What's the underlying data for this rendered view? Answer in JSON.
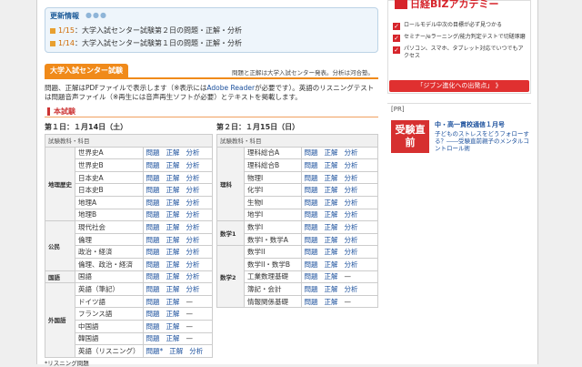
{
  "news": {
    "title": "更新情報",
    "dots": "●●●",
    "items": [
      {
        "date": "1/15",
        "text": "：大学入試センター試験第２日の問題・正解・分析"
      },
      {
        "date": "1/14",
        "text": "：大学入試センター試験第１日の問題・正解・分析"
      }
    ]
  },
  "section": {
    "tab": "大学入試センター試験",
    "note": "問題と正解は大学入試センター発表。分析は河合塾。",
    "intro_a": "問題、正解はPDFファイルで表示します（※表示には",
    "intro_link": "Adobe Reader",
    "intro_b": "が必要です）。英語のリスニングテストは問題音声ファイル（※再生には音声再生ソフトが必要）とテキストを掲載します。",
    "honshiken": "本試験"
  },
  "day1": {
    "title": "第１日：１月14日（土）",
    "header": "試験教科・科目",
    "groups": [
      {
        "cat": "地理歴史",
        "rows": [
          {
            "subj": "世界史A",
            "links": [
              "問題",
              "正解",
              "分析"
            ]
          },
          {
            "subj": "世界史B",
            "links": [
              "問題",
              "正解",
              "分析"
            ]
          },
          {
            "subj": "日本史A",
            "links": [
              "問題",
              "正解",
              "分析"
            ]
          },
          {
            "subj": "日本史B",
            "links": [
              "問題",
              "正解",
              "分析"
            ]
          },
          {
            "subj": "地理A",
            "links": [
              "問題",
              "正解",
              "分析"
            ]
          },
          {
            "subj": "地理B",
            "links": [
              "問題",
              "正解",
              "分析"
            ]
          }
        ]
      },
      {
        "cat": "公民",
        "rows": [
          {
            "subj": "現代社会",
            "links": [
              "問題",
              "正解",
              "分析"
            ]
          },
          {
            "subj": "倫理",
            "links": [
              "問題",
              "正解",
              "分析"
            ]
          },
          {
            "subj": "政治・経済",
            "links": [
              "問題",
              "正解",
              "分析"
            ]
          },
          {
            "subj": "倫理、政治・経済",
            "links": [
              "問題",
              "正解",
              "分析"
            ]
          }
        ]
      },
      {
        "cat": "国語",
        "rows": [
          {
            "subj": "国語",
            "links": [
              "問題",
              "正解",
              "分析"
            ]
          }
        ]
      },
      {
        "cat": "外国語",
        "rows": [
          {
            "subj": "英語（筆記）",
            "links": [
              "問題",
              "正解",
              "分析"
            ]
          },
          {
            "subj": "ドイツ語",
            "links": [
              "問題",
              "正解",
              "—"
            ]
          },
          {
            "subj": "フランス語",
            "links": [
              "問題",
              "正解",
              "—"
            ]
          },
          {
            "subj": "中国語",
            "links": [
              "問題",
              "正解",
              "—"
            ]
          },
          {
            "subj": "韓国語",
            "links": [
              "問題",
              "正解",
              "—"
            ]
          },
          {
            "subj": "英語（リスニング）",
            "links": [
              "問題*",
              "正解",
              "分析"
            ]
          }
        ]
      }
    ]
  },
  "day2": {
    "title": "第２日：１月15日（日）",
    "header": "試験教科・科目",
    "groups": [
      {
        "cat": "理科",
        "rows": [
          {
            "subj": "理科総合A",
            "links": [
              "問題",
              "正解",
              "分析"
            ]
          },
          {
            "subj": "理科総合B",
            "links": [
              "問題",
              "正解",
              "分析"
            ]
          },
          {
            "subj": "物理I",
            "links": [
              "問題",
              "正解",
              "分析"
            ]
          },
          {
            "subj": "化学I",
            "links": [
              "問題",
              "正解",
              "分析"
            ]
          },
          {
            "subj": "生物I",
            "links": [
              "問題",
              "正解",
              "分析"
            ]
          },
          {
            "subj": "地学I",
            "links": [
              "問題",
              "正解",
              "分析"
            ]
          }
        ]
      },
      {
        "cat": "数学1",
        "rows": [
          {
            "subj": "数学I",
            "links": [
              "問題",
              "正解",
              "分析"
            ]
          },
          {
            "subj": "数学I・数学A",
            "links": [
              "問題",
              "正解",
              "分析"
            ]
          }
        ]
      },
      {
        "cat": "数学2",
        "rows": [
          {
            "subj": "数学II",
            "links": [
              "問題",
              "正解",
              "分析"
            ]
          },
          {
            "subj": "数学II・数学B",
            "links": [
              "問題",
              "正解",
              "分析"
            ]
          },
          {
            "subj": "工業数理基礎",
            "links": [
              "問題",
              "正解",
              "—"
            ]
          },
          {
            "subj": "簿記・会計",
            "links": [
              "問題",
              "正解",
              "分析"
            ]
          },
          {
            "subj": "情報関係基礎",
            "links": [
              "問題",
              "正解",
              "—"
            ]
          }
        ]
      }
    ]
  },
  "footnote": "*リスニング問題",
  "ad": {
    "logo": "日経BIZアカデミー",
    "items": [
      "ロールモデル中次の目標が必ず見つかる",
      "セミナー/eラーニング/能力判定テストで切磋琢磨",
      "パソコン、スマホ、タブレット対応でいつでもアクセス"
    ],
    "button": "「ジブン進化への出発点」 》"
  },
  "pr": {
    "label": "[PR]",
    "image_text": "受験直前",
    "title": "中・高一貫校通信１月号",
    "text": "子どものストレスをどうフォローする？――受験直前親子のメンタルコントロール術"
  }
}
